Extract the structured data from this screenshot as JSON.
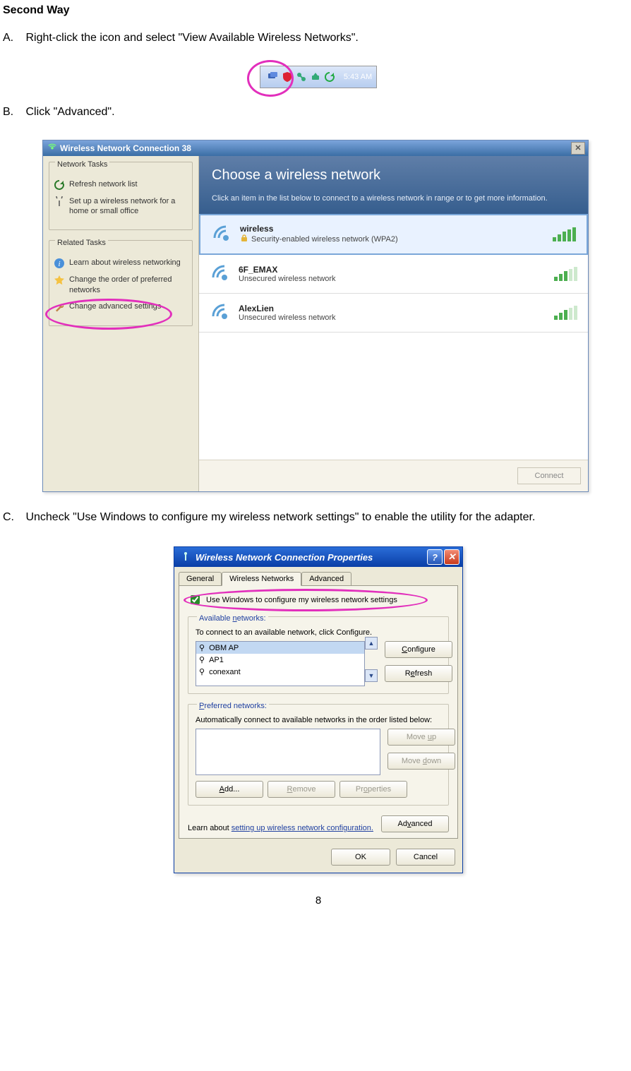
{
  "heading": "Second Way",
  "steps": {
    "a": {
      "label": "A.",
      "text": "Right-click the icon and select \"View Available Wireless Networks\"."
    },
    "b": {
      "label": "B.",
      "text": "Click \"Advanced\"."
    },
    "c": {
      "label": "C.",
      "text": "Uncheck \"Use Windows to configure my wireless network settings\" to enable the utility for the adapter."
    }
  },
  "tray": {
    "time": "5:43 AM"
  },
  "win38": {
    "title": "Wireless Network Connection 38",
    "taskGroups": {
      "network": {
        "legend": "Network Tasks",
        "items": [
          "Refresh network list",
          "Set up a wireless network for a home or small office"
        ]
      },
      "related": {
        "legend": "Related Tasks",
        "items": [
          "Learn about wireless networking",
          "Change the order of preferred networks",
          "Change advanced settings"
        ]
      }
    },
    "header": {
      "title": "Choose a wireless network",
      "subtitle": "Click an item in the list below to connect to a wireless network in range or to get more information."
    },
    "networks": [
      {
        "name": "wireless",
        "typeLabel": "Security-enabled wireless network (WPA2)",
        "secured": true,
        "selected": true
      },
      {
        "name": "6F_EMAX",
        "typeLabel": "Unsecured wireless network",
        "secured": false,
        "selected": false
      },
      {
        "name": "AlexLien",
        "typeLabel": "Unsecured wireless network",
        "secured": false,
        "selected": false
      }
    ],
    "connectBtn": "Connect"
  },
  "props": {
    "title": "Wireless Network Connection Properties",
    "tabs": [
      "General",
      "Wireless Networks",
      "Advanced"
    ],
    "activeTab": 1,
    "checkboxLabel": "Use Windows to configure my wireless network settings",
    "available": {
      "legend": "Available networks:",
      "hint": "To connect to an available network, click Configure.",
      "items": [
        "OBM AP",
        "AP1",
        "conexant"
      ],
      "buttons": {
        "configure": "Configure",
        "refresh": "Refresh"
      }
    },
    "preferred": {
      "legend": "Preferred networks:",
      "hint": "Automatically connect to available networks in the order listed below:",
      "buttons": {
        "moveup": "Move up",
        "movedown": "Move down",
        "add": "Add...",
        "remove": "Remove",
        "properties": "Properties"
      }
    },
    "learn": {
      "prefix": "Learn about ",
      "link": "setting up wireless network configuration."
    },
    "advancedBtn": "Advanced",
    "ok": "OK",
    "cancel": "Cancel"
  },
  "pageNumber": "8"
}
